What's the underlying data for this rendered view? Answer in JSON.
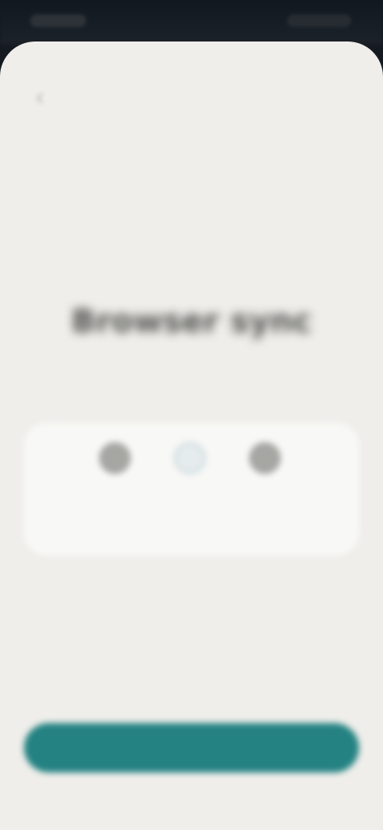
{
  "colors": {
    "sheet_background": "#efeeea",
    "card_background": "#f8f8f6",
    "accent": "#248282",
    "status_bar": "#141a20"
  },
  "nav": {
    "back_icon": "chevron-left-icon"
  },
  "hero": {
    "title": "Browser sync",
    "subtitle": ""
  },
  "card": {
    "left_icon": "device-icon",
    "center_icon": "sync-icon",
    "right_icon": "device-icon",
    "status": ""
  },
  "footer": {
    "primary_label": ""
  }
}
